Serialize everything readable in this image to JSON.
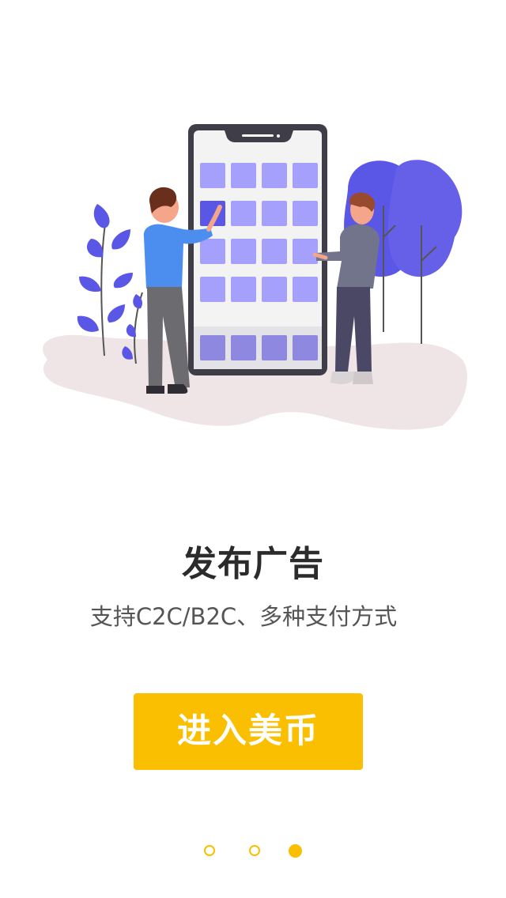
{
  "onboarding": {
    "title": "发布广告",
    "subtitle": "支持C2C/B2C、多种支付方式",
    "enter_button_label": "进入美币"
  },
  "pager": {
    "pages": 3,
    "active_index": 2
  },
  "colors": {
    "accent": "#f9bf00",
    "illustration_purple": "#5b57e6",
    "app_tile": "#a5a0fb",
    "ground_blob": "#efe4e6"
  },
  "icons": {
    "illustration": "phone-app-grid-people-illustration"
  }
}
